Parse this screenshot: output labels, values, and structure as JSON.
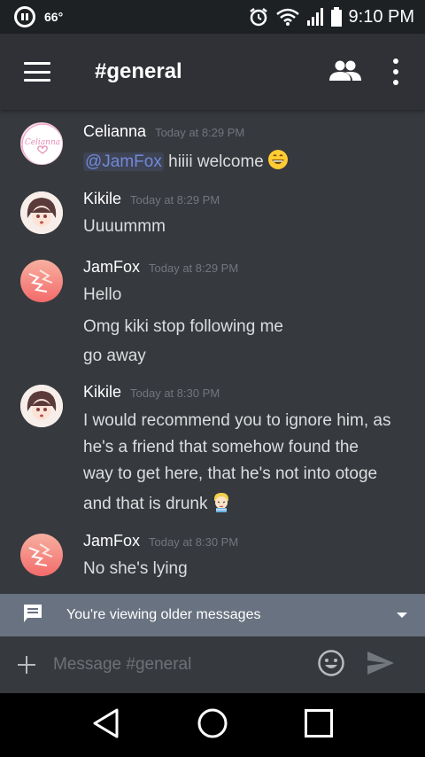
{
  "status_bar": {
    "temperature": "66°",
    "time": "9:10 PM"
  },
  "header": {
    "channel": "#general",
    "menu_icon": "hamburger-icon",
    "members_icon": "members-icon",
    "overflow_icon": "more-vert-icon"
  },
  "messages": [
    {
      "author": "Celianna",
      "timestamp": "Today at 8:29 PM",
      "mention": "@JamFox",
      "text": " hiiii welcome",
      "emoji": "grinning-face"
    },
    {
      "author": "Kikile",
      "timestamp": "Today at 8:29 PM",
      "lines": [
        "Uuuummm"
      ]
    },
    {
      "author": "JamFox",
      "timestamp": "Today at 8:29 PM",
      "lines": [
        "Hello",
        "Omg kiki stop following me",
        "go away"
      ]
    },
    {
      "author": "Kikile",
      "timestamp": "Today at 8:30 PM",
      "lines": [
        "I would recommend you to ignore him, as",
        "he's a friend that somehow found the",
        "way to get here, that he's not into otoge",
        "and that is drunk"
      ],
      "emoji": "drunk-sticker"
    },
    {
      "author": "JamFox",
      "timestamp": "Today at 8:30 PM",
      "lines": [
        "No she's lying"
      ]
    }
  ],
  "avatar_texts": {
    "celianna": "Celianna"
  },
  "older_bar": {
    "text": "You're viewing older messages"
  },
  "input": {
    "placeholder": "Message #general"
  },
  "colors": {
    "background": "#36393e",
    "header": "#2f3136",
    "mention": "#7289da",
    "older_bar": "#697280"
  }
}
